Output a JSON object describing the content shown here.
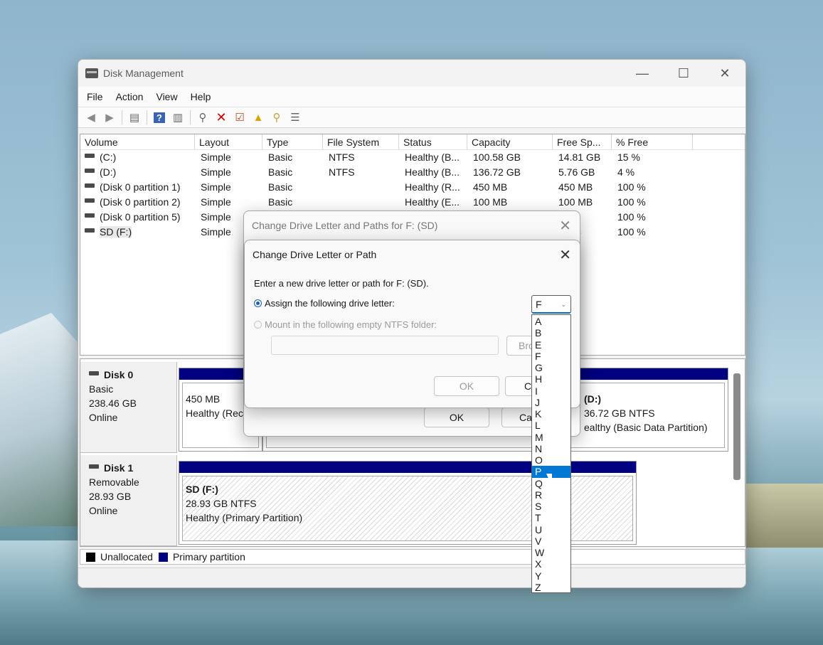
{
  "window": {
    "title": "Disk Management",
    "controls": {
      "minimize": "—",
      "maximize": "☐",
      "close": "✕"
    }
  },
  "menu": [
    "File",
    "Action",
    "View",
    "Help"
  ],
  "toolbar": {
    "icons": [
      "back-icon",
      "forward-icon",
      "console-tree-icon",
      "help-icon",
      "show-hide-icon",
      "connect-icon",
      "delete-icon",
      "properties-icon",
      "import-icon",
      "search-icon",
      "list-view-icon"
    ]
  },
  "volumes": {
    "columns": [
      "Volume",
      "Layout",
      "Type",
      "File System",
      "Status",
      "Capacity",
      "Free Sp...",
      "% Free"
    ],
    "rows": [
      {
        "volume": "(C:)",
        "layout": "Simple",
        "type": "Basic",
        "fs": "NTFS",
        "status": "Healthy (B...",
        "capacity": "100.58 GB",
        "free": "14.81 GB",
        "pct": "15 %"
      },
      {
        "volume": "(D:)",
        "layout": "Simple",
        "type": "Basic",
        "fs": "NTFS",
        "status": "Healthy (B...",
        "capacity": "136.72 GB",
        "free": "5.76 GB",
        "pct": "4 %"
      },
      {
        "volume": "(Disk 0 partition 1)",
        "layout": "Simple",
        "type": "Basic",
        "fs": "",
        "status": "Healthy (R...",
        "capacity": "450 MB",
        "free": "450 MB",
        "pct": "100 %"
      },
      {
        "volume": "(Disk 0 partition 2)",
        "layout": "Simple",
        "type": "Basic",
        "fs": "",
        "status": "Healthy (E...",
        "capacity": "100 MB",
        "free": "100 MB",
        "pct": "100 %"
      },
      {
        "volume": "(Disk 0 partition 5)",
        "layout": "Simple",
        "type": "",
        "fs": "",
        "status": "",
        "capacity": "",
        "free": "MB",
        "pct": "100 %"
      },
      {
        "volume": "SD (F:)",
        "layout": "Simple",
        "type": "",
        "fs": "",
        "status": "",
        "capacity": "",
        "free": "5 GB",
        "pct": "100 %"
      }
    ]
  },
  "disks": [
    {
      "name": "Disk 0",
      "kind": "Basic",
      "size": "238.46 GB",
      "state": "Online",
      "p1_size": "450 MB",
      "p1_status": "Healthy (Rec",
      "d_title": "(D:)",
      "d_size": "36.72 GB NTFS",
      "d_status": "ealthy (Basic Data Partition)"
    },
    {
      "name": "Disk 1",
      "kind": "Removable",
      "size": "28.93 GB",
      "state": "Online",
      "p_title": "SD  (F:)",
      "p_size": "28.93 GB NTFS",
      "p_status": "Healthy (Primary Partition)"
    }
  ],
  "legend": {
    "unallocated": "Unallocated",
    "primary": "Primary partition",
    "unallocated_color": "#000000",
    "primary_color": "#000080"
  },
  "dialog_back": {
    "title": "Change Drive Letter and Paths for F: (SD)",
    "ok": "OK",
    "cancel": "Ca"
  },
  "dialog_front": {
    "title": "Change Drive Letter or Path",
    "prompt": "Enter a new drive letter or path for F: (SD).",
    "assign_label": "Assign the following drive letter:",
    "mount_label": "Mount in the following empty NTFS folder:",
    "browse": "Bro",
    "ok": "OK",
    "cancel": "C"
  },
  "dropdown": {
    "selected": "F",
    "options": [
      "A",
      "B",
      "E",
      "F",
      "G",
      "H",
      "I",
      "J",
      "K",
      "L",
      "M",
      "N",
      "O",
      "P",
      "Q",
      "R",
      "S",
      "T",
      "U",
      "V",
      "W",
      "X",
      "Y",
      "Z"
    ],
    "highlighted": "P",
    "accent_color": "#0078d4"
  }
}
